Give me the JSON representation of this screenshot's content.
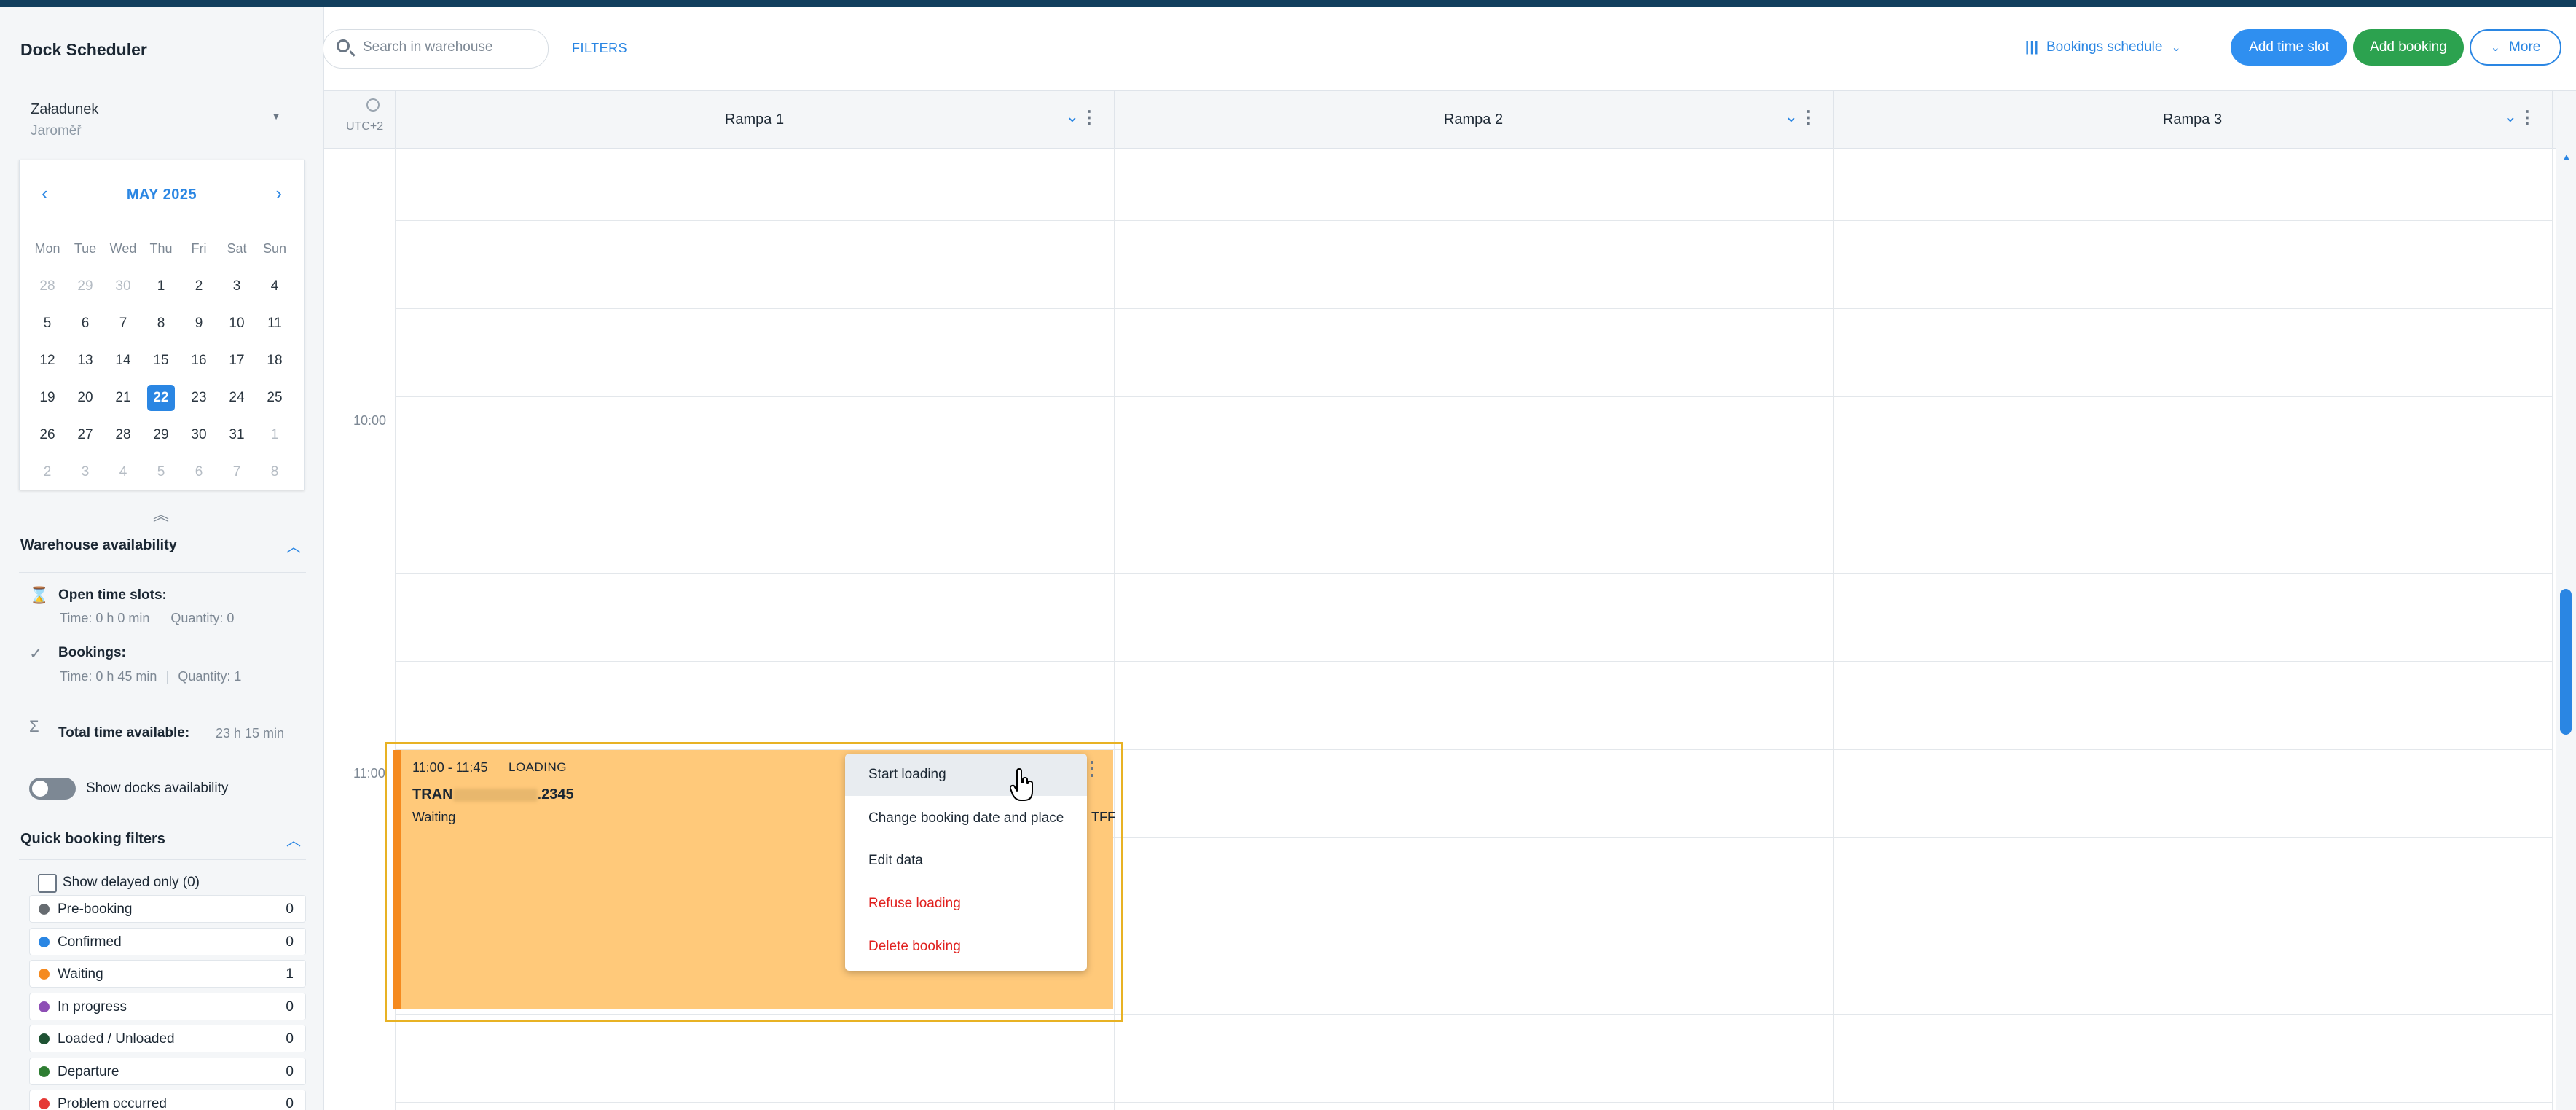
{
  "app": {
    "title": "Dock Scheduler"
  },
  "warehouse": {
    "name": "Załadunek",
    "location": "Jaroměř"
  },
  "calendar": {
    "month_label": "MAY 2025",
    "weekdays": [
      "Mon",
      "Tue",
      "Wed",
      "Thu",
      "Fri",
      "Sat",
      "Sun"
    ],
    "weeks": [
      [
        "28",
        "29",
        "30",
        "1",
        "2",
        "3",
        "4"
      ],
      [
        "5",
        "6",
        "7",
        "8",
        "9",
        "10",
        "11"
      ],
      [
        "12",
        "13",
        "14",
        "15",
        "16",
        "17",
        "18"
      ],
      [
        "19",
        "20",
        "21",
        "22",
        "23",
        "24",
        "25"
      ],
      [
        "26",
        "27",
        "28",
        "29",
        "30",
        "31",
        "1"
      ],
      [
        "2",
        "3",
        "4",
        "5",
        "6",
        "7",
        "8"
      ]
    ],
    "selected_day": "22"
  },
  "availability": {
    "title": "Warehouse availability",
    "open_slots_label": "Open time slots:",
    "open_slots_time": "Time: 0 h 0 min",
    "open_slots_qty": "Quantity: 0",
    "bookings_label": "Bookings:",
    "bookings_time": "Time: 0 h 45 min",
    "bookings_qty": "Quantity: 1",
    "total_label": "Total time available:",
    "total_value": "23 h 15 min",
    "show_docks_label": "Show docks availability"
  },
  "quick_filters": {
    "title": "Quick booking filters",
    "delayed_label": "Show delayed only (0)",
    "items": [
      {
        "label": "Pre-booking",
        "count": "0",
        "color": "#666b70"
      },
      {
        "label": "Confirmed",
        "count": "0",
        "color": "#2a86e3"
      },
      {
        "label": "Waiting",
        "count": "1",
        "color": "#f58a1f"
      },
      {
        "label": "In progress",
        "count": "0",
        "color": "#8e4fb5"
      },
      {
        "label": "Loaded / Unloaded",
        "count": "0",
        "color": "#1e5233"
      },
      {
        "label": "Departure",
        "count": "0",
        "color": "#2e7d32"
      },
      {
        "label": "Problem occurred",
        "count": "0",
        "color": "#e53935"
      }
    ]
  },
  "toolbar": {
    "search_placeholder": "Search in warehouse",
    "filters_label": "FILTERS",
    "view_label": "Bookings schedule",
    "add_time_slot": "Add time slot",
    "add_booking": "Add booking",
    "more": "More"
  },
  "schedule": {
    "timezone": "UTC+2",
    "docks": [
      "Rampa 1",
      "Rampa 2",
      "Rampa 3"
    ],
    "time_labels": [
      "10:00",
      "11:00"
    ]
  },
  "booking": {
    "time": "11:00 - 11:45",
    "status": "LOADING",
    "ref_prefix": "TRAN",
    "ref_suffix": ".2345",
    "substatus": "Waiting",
    "extra": "TFF"
  },
  "context_menu": {
    "items": [
      "Start loading",
      "Change booking date and place",
      "Edit data",
      "Refuse loading",
      "Delete booking"
    ]
  }
}
